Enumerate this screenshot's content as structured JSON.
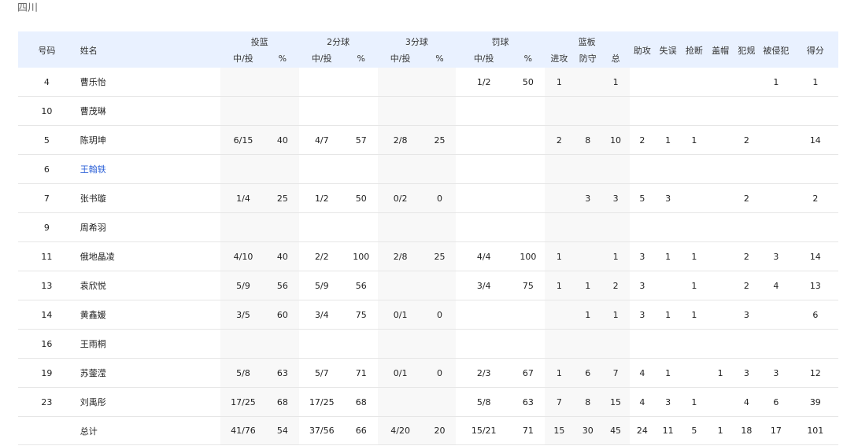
{
  "team": "四川",
  "header": {
    "number": "号码",
    "name": "姓名",
    "groups": {
      "fg": "投篮",
      "two": "2分球",
      "three": "3分球",
      "ft": "罚球",
      "reb": "篮板"
    },
    "made_att": "中/投",
    "pct": "%",
    "off": "进攻",
    "def": "防守",
    "tot": "总",
    "ast": "助攻",
    "tov": "失误",
    "stl": "抢断",
    "blk": "盖帽",
    "pf": "犯规",
    "fd": "被侵犯",
    "pts": "得分"
  },
  "rows": [
    [
      "4",
      "曹乐怡",
      "",
      "",
      "",
      "",
      "",
      "",
      "1/2",
      "50",
      "1",
      "",
      "1",
      "",
      "",
      "",
      "",
      "",
      "1",
      "1"
    ],
    [
      "10",
      "曹茂琳",
      "",
      "",
      "",
      "",
      "",
      "",
      "",
      "",
      "",
      "",
      "",
      "",
      "",
      "",
      "",
      "",
      "",
      ""
    ],
    [
      "5",
      "陈玥坤",
      "6/15",
      "40",
      "4/7",
      "57",
      "2/8",
      "25",
      "",
      "",
      "2",
      "8",
      "10",
      "2",
      "1",
      "1",
      "",
      "2",
      "",
      "14"
    ],
    [
      "6",
      "王翰轶",
      "",
      "",
      "",
      "",
      "",
      "",
      "",
      "",
      "",
      "",
      "",
      "",
      "",
      "",
      "",
      "",
      "",
      ""
    ],
    [
      "7",
      "张书璇",
      "1/4",
      "25",
      "1/2",
      "50",
      "0/2",
      "0",
      "",
      "",
      "",
      "3",
      "3",
      "5",
      "3",
      "",
      "",
      "2",
      "",
      "2"
    ],
    [
      "9",
      "周希羽",
      "",
      "",
      "",
      "",
      "",
      "",
      "",
      "",
      "",
      "",
      "",
      "",
      "",
      "",
      "",
      "",
      "",
      ""
    ],
    [
      "11",
      "俄地晶凌",
      "4/10",
      "40",
      "2/2",
      "100",
      "2/8",
      "25",
      "4/4",
      "100",
      "1",
      "",
      "1",
      "3",
      "1",
      "1",
      "",
      "2",
      "3",
      "14"
    ],
    [
      "13",
      "袁欣悦",
      "5/9",
      "56",
      "5/9",
      "56",
      "",
      "",
      "3/4",
      "75",
      "1",
      "1",
      "2",
      "3",
      "",
      "1",
      "",
      "2",
      "4",
      "13"
    ],
    [
      "14",
      "黄鑫媛",
      "3/5",
      "60",
      "3/4",
      "75",
      "0/1",
      "0",
      "",
      "",
      "",
      "1",
      "1",
      "3",
      "1",
      "1",
      "",
      "3",
      "",
      "6"
    ],
    [
      "16",
      "王雨桐",
      "",
      "",
      "",
      "",
      "",
      "",
      "",
      "",
      "",
      "",
      "",
      "",
      "",
      "",
      "",
      "",
      "",
      ""
    ],
    [
      "19",
      "苏蓥滢",
      "5/8",
      "63",
      "5/7",
      "71",
      "0/1",
      "0",
      "2/3",
      "67",
      "1",
      "6",
      "7",
      "4",
      "1",
      "",
      "1",
      "3",
      "3",
      "12"
    ],
    [
      "23",
      "刘禹彤",
      "17/25",
      "68",
      "17/25",
      "68",
      "",
      "",
      "5/8",
      "63",
      "7",
      "8",
      "15",
      "4",
      "3",
      "1",
      "",
      "4",
      "6",
      "39"
    ],
    [
      "",
      "总计",
      "41/76",
      "54",
      "37/56",
      "66",
      "4/20",
      "20",
      "15/21",
      "71",
      "15",
      "30",
      "45",
      "24",
      "11",
      "5",
      "1",
      "18",
      "17",
      "101"
    ]
  ],
  "linked_rows": [
    3
  ],
  "accent_link": "#2f63d8",
  "header_bg": "#e9f1ff"
}
